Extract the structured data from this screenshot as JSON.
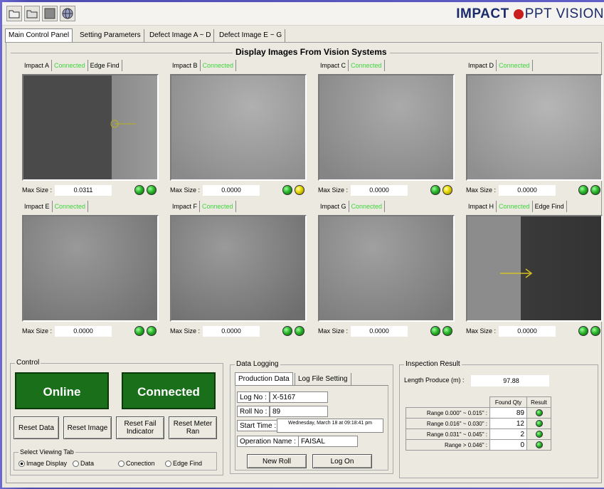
{
  "brand": {
    "name": "IMPACT",
    "suffix": "PPT VISION"
  },
  "toolbar": {
    "icons": [
      "folder-open-icon",
      "folder-icon",
      "stop-icon",
      "globe-icon"
    ]
  },
  "tabs": [
    "Main Control Panel",
    "Setting Parameters",
    "Defect Image A ~ D",
    "Defect Image E ~ G"
  ],
  "display_title": "Display Images From Vision Systems",
  "cameras": [
    {
      "name": "Impact A",
      "status": "Connected",
      "extra": "Edge Find",
      "max_label": "Max Size :",
      "max_value": "0.0311",
      "leds": [
        "green",
        "green"
      ]
    },
    {
      "name": "Impact B",
      "status": "Connected",
      "extra": "",
      "max_label": "Max Size :",
      "max_value": "0.0000",
      "leds": [
        "green",
        "yellow"
      ]
    },
    {
      "name": "Impact C",
      "status": "Connected",
      "extra": "",
      "max_label": "Max Size :",
      "max_value": "0.0000",
      "leds": [
        "green",
        "yellow"
      ]
    },
    {
      "name": "Impact D",
      "status": "Connected",
      "extra": "",
      "max_label": "Max Size :",
      "max_value": "0.0000",
      "leds": [
        "green",
        "green"
      ]
    },
    {
      "name": "Impact E",
      "status": "Connected",
      "extra": "",
      "max_label": "Max Size :",
      "max_value": "0.0000",
      "leds": [
        "green",
        "green"
      ]
    },
    {
      "name": "Impact F",
      "status": "Connected",
      "extra": "",
      "max_label": "Max Size :",
      "max_value": "0.0000",
      "leds": [
        "green",
        "green"
      ]
    },
    {
      "name": "Impact G",
      "status": "Connected",
      "extra": "",
      "max_label": "Max Size :",
      "max_value": "0.0000",
      "leds": [
        "green",
        "green"
      ]
    },
    {
      "name": "Impact H",
      "status": "Connected",
      "extra": "Edge Find",
      "max_label": "Max Size :",
      "max_value": "0.0000",
      "leds": [
        "green",
        "green"
      ]
    }
  ],
  "control": {
    "title": "Control",
    "online": "Online",
    "connected": "Connected",
    "buttons": [
      "Reset Data",
      "Reset Image",
      "Reset Fail Indicator",
      "Reset Meter Ran"
    ],
    "viewing_title": "Select Viewing Tab",
    "viewing_options": [
      "Image Display",
      "Data",
      "Conection",
      "Edge Find"
    ],
    "viewing_selected": "Image Display"
  },
  "logging": {
    "title": "Data Logging",
    "tabs": [
      "Production Data",
      "Log File Setting"
    ],
    "log_no_label": "Log No :",
    "log_no": "X-5167",
    "roll_no_label": "Roll No :",
    "roll_no": "89",
    "start_label": "Start Time :",
    "start_time": "Wednesday, March 18 at 09:18:41 pm",
    "operator_label": "Operation Name :",
    "operator": "FAISAL",
    "new_roll": "New Roll",
    "log_on": "Log On"
  },
  "inspection": {
    "title": "Inspection Result",
    "length_label": "Length Produce (m) :",
    "length_value": "97.88",
    "col_found": "Found Qty",
    "col_result": "Result",
    "rows": [
      {
        "range": "Range 0.000\" ~ 0.015\" :",
        "qty": "89"
      },
      {
        "range": "Range 0.016\" ~ 0.030\" :",
        "qty": "12"
      },
      {
        "range": "Range 0.031\" ~ 0.045\" :",
        "qty": "2"
      },
      {
        "range": "Range > 0.046\" :",
        "qty": "0"
      }
    ]
  }
}
